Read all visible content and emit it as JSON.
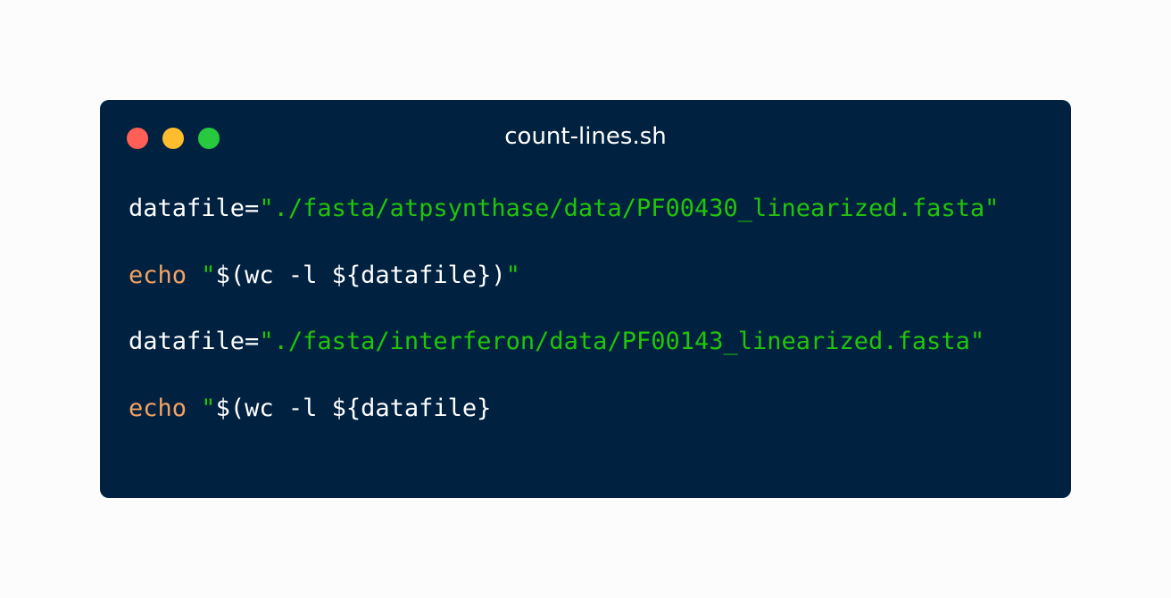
{
  "window": {
    "title": "count-lines.sh",
    "buttons": {
      "close_color": "#ff5f56",
      "minimize_color": "#ffbd2e",
      "maximize_color": "#27c93f"
    }
  },
  "colors": {
    "background": "#fcfcfc",
    "editor_background": "#002140",
    "keyword": "#f4a261",
    "string": "#22c40a",
    "text": "#ffffff"
  },
  "code_lines": [
    {
      "var": "datafile=",
      "string": "\"./fasta/atpsynthase/data/PF00430_linearized.fasta\""
    },
    {
      "keyword": "echo",
      "space": " ",
      "quote_open": "\"",
      "expr": "$(wc -l ${datafile})",
      "quote_close": "\""
    },
    {
      "var": "datafile=",
      "string": "\"./fasta/interferon/data/PF00143_linearized.fasta\""
    },
    {
      "keyword": "echo",
      "space": " ",
      "quote_open": "\"",
      "expr": "$(wc -l ${datafile}"
    }
  ]
}
